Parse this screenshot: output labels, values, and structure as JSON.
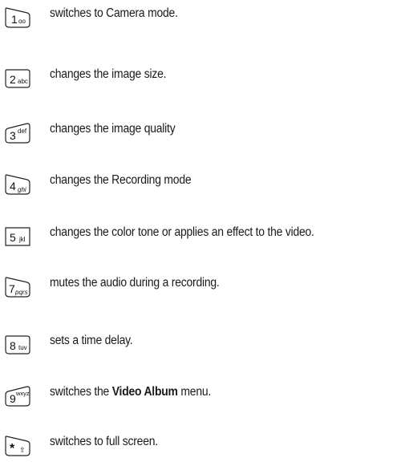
{
  "items": [
    {
      "key_main": "1",
      "key_sub": "oo",
      "text": "switches to Camera mode."
    },
    {
      "key_main": "2",
      "key_sub": "abc",
      "text": "changes the image size."
    },
    {
      "key_main": "3",
      "key_sub": "def",
      "text": "changes the image quality"
    },
    {
      "key_main": "4",
      "key_sub": "ghi",
      "text": "changes the Recording mode"
    },
    {
      "key_main": "5",
      "key_sub": "jkl",
      "text": "changes the color tone or applies an effect to the video."
    },
    {
      "key_main": "7",
      "key_sub": "pqrs",
      "text": "mutes the audio during a recording."
    },
    {
      "key_main": "8",
      "key_sub": "tuv",
      "text": "sets a time delay."
    },
    {
      "key_main": "9",
      "key_sub": "wxyz",
      "text_before": "switches the ",
      "text_bold": "Video Album",
      "text_after": " menu."
    },
    {
      "key_main": "*",
      "key_sub": "⇧",
      "text": "switches to full screen."
    }
  ]
}
